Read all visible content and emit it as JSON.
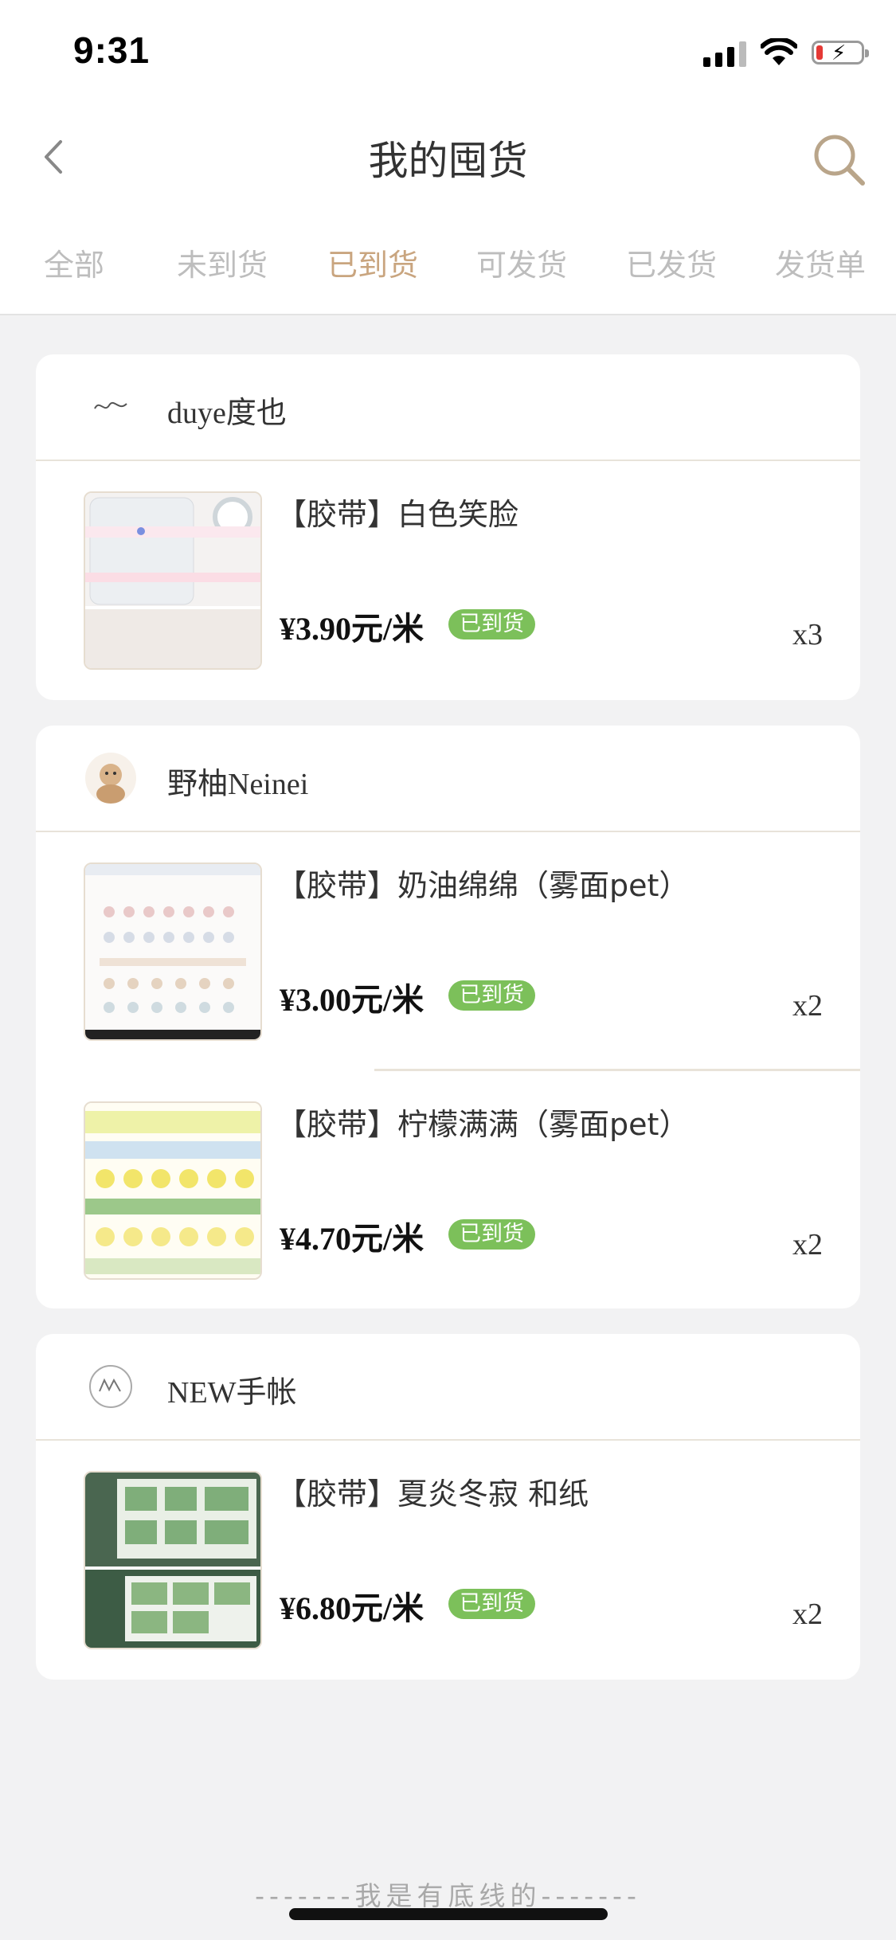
{
  "status_bar": {
    "time": "9:31"
  },
  "nav": {
    "title": "我的囤货"
  },
  "tabs": [
    {
      "label": "全部",
      "active": false
    },
    {
      "label": "未到货",
      "active": false
    },
    {
      "label": "已到货",
      "active": true
    },
    {
      "label": "可发货",
      "active": false
    },
    {
      "label": "已发货",
      "active": false
    },
    {
      "label": "发货单",
      "active": false
    }
  ],
  "colors": {
    "accent": "#c9a57f",
    "badge": "#7cc05a",
    "background": "#f2f2f3"
  },
  "shops": [
    {
      "name": "duye度也",
      "items": [
        {
          "title": "【胶带】白色笑脸",
          "price": "¥3.90元/米",
          "status": "已到货",
          "qty": "x3"
        }
      ]
    },
    {
      "name": "野柚Neinei",
      "items": [
        {
          "title": "【胶带】奶油绵绵（雾面pet）",
          "price": "¥3.00元/米",
          "status": "已到货",
          "qty": "x2"
        },
        {
          "title": "【胶带】柠檬满满（雾面pet）",
          "price": "¥4.70元/米",
          "status": "已到货",
          "qty": "x2"
        }
      ]
    },
    {
      "name": "NEW手帐",
      "items": [
        {
          "title": "【胶带】夏炎冬寂 和纸",
          "price": "¥6.80元/米",
          "status": "已到货",
          "qty": "x2"
        }
      ]
    }
  ],
  "footer": {
    "text": "-------我是有底线的-------"
  }
}
